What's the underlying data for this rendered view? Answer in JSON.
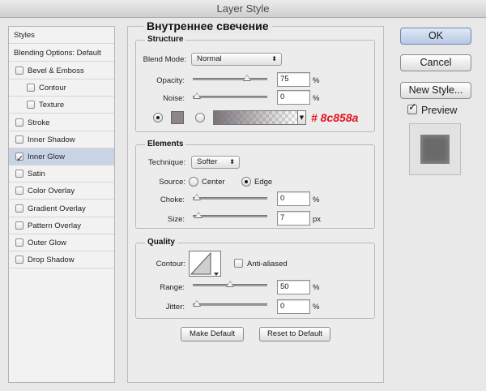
{
  "window": {
    "title": "Layer Style"
  },
  "styles_panel": {
    "header": "Styles",
    "blending": "Blending Options: Default",
    "items": [
      {
        "label": "Bevel & Emboss",
        "checked": false
      },
      {
        "label": "Contour",
        "checked": false
      },
      {
        "label": "Texture",
        "checked": false
      },
      {
        "label": "Stroke",
        "checked": false
      },
      {
        "label": "Inner Shadow",
        "checked": false
      },
      {
        "label": "Inner Glow",
        "checked": true
      },
      {
        "label": "Satin",
        "checked": false
      },
      {
        "label": "Color Overlay",
        "checked": false
      },
      {
        "label": "Gradient Overlay",
        "checked": false
      },
      {
        "label": "Pattern Overlay",
        "checked": false
      },
      {
        "label": "Outer Glow",
        "checked": false
      },
      {
        "label": "Drop Shadow",
        "checked": false
      }
    ]
  },
  "panel": {
    "heading": "Внутреннее свечение",
    "structure": {
      "title": "Structure",
      "blend_mode_label": "Blend Mode:",
      "blend_mode_value": "Normal",
      "opacity_label": "Opacity:",
      "opacity_value": "75",
      "opacity_fraction": 0.75,
      "noise_label": "Noise:",
      "noise_value": "0",
      "noise_fraction": 0,
      "percent": "%",
      "color_annotation": "# 8c858a",
      "swatch_color": "#8c858a",
      "annotation_color": "#e3111b"
    },
    "elements": {
      "title": "Elements",
      "technique_label": "Technique:",
      "technique_value": "Softer",
      "source_label": "Source:",
      "center_label": "Center",
      "edge_label": "Edge",
      "choke_label": "Choke:",
      "choke_value": "0",
      "choke_fraction": 0,
      "size_label": "Size:",
      "size_value": "7",
      "size_unit": "px",
      "size_fraction": 0.03,
      "percent": "%"
    },
    "quality": {
      "title": "Quality",
      "contour_label": "Contour:",
      "anti_aliased_label": "Anti-aliased",
      "range_label": "Range:",
      "range_value": "50",
      "range_fraction": 0.5,
      "jitter_label": "Jitter:",
      "jitter_value": "0",
      "jitter_fraction": 0,
      "percent": "%"
    },
    "make_default": "Make Default",
    "reset_default": "Reset to Default"
  },
  "buttons": {
    "ok": "OK",
    "cancel": "Cancel",
    "new_style": "New Style...",
    "preview": "Preview",
    "preview_checked": true
  }
}
